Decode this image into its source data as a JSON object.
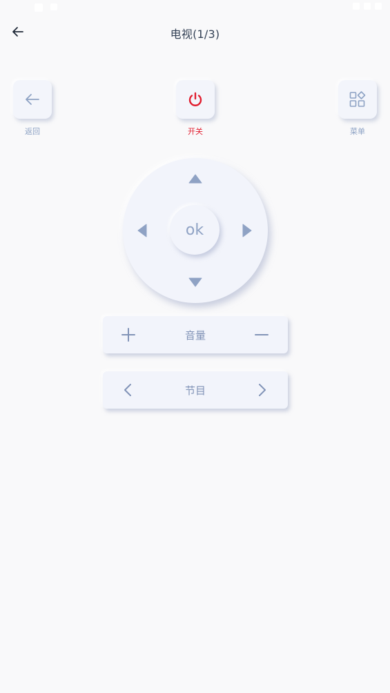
{
  "header": {
    "title": "电视(1/3)"
  },
  "top_keys": {
    "back_label": "返回",
    "power_label": "开关",
    "menu_label": "菜单"
  },
  "dpad": {
    "ok_label": "ok"
  },
  "volume": {
    "label": "音量"
  },
  "channel": {
    "label": "节目"
  },
  "colors": {
    "background": "#f9f9fa",
    "key_bg": "#f3f5fb",
    "icon": "#8da2c4",
    "power": "#e11d2e",
    "title": "#334155"
  }
}
